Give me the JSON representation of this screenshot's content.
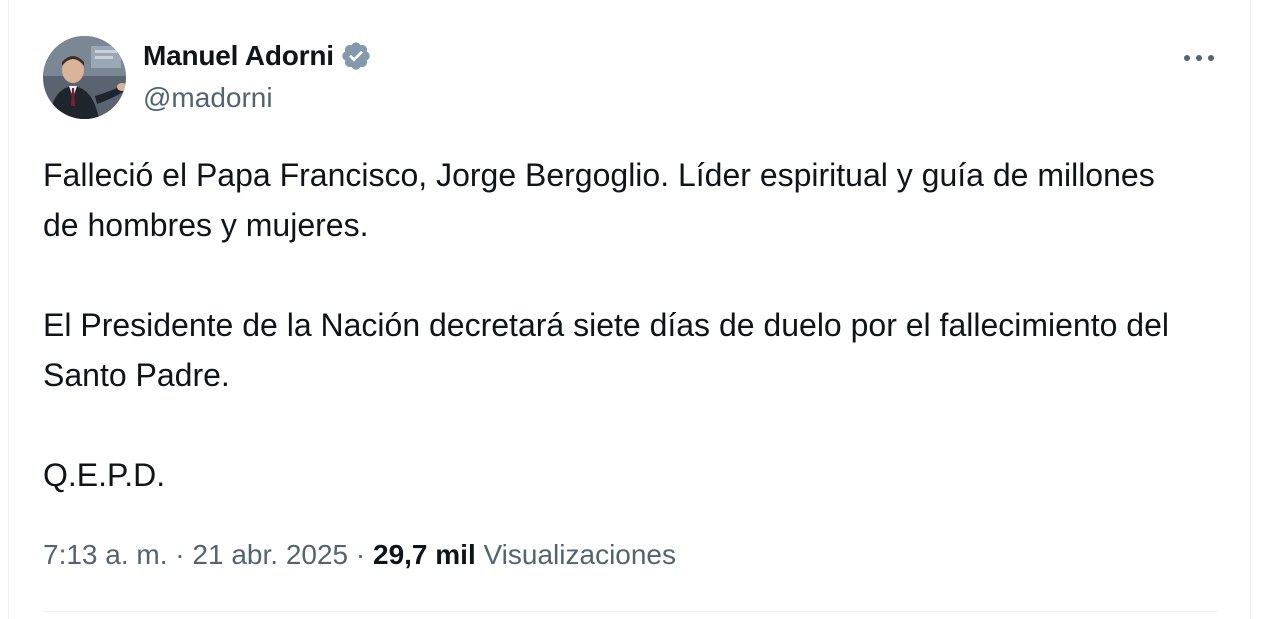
{
  "author": {
    "name": "Manuel Adorni",
    "handle": "@madorni",
    "verified": true
  },
  "tweet": {
    "paragraphs": [
      "Falleció el Papa Francisco, Jorge Bergoglio. Líder espiritual y guía de millones de hombres y mujeres.",
      "El Presidente de la Nación decretará siete días de duelo por el fallecimiento del Santo Padre.",
      "Q.E.P.D."
    ]
  },
  "meta": {
    "time": "7:13 a. m.",
    "separator": "·",
    "date": "21 abr. 2025",
    "views_count": "29,7 mil",
    "views_label": "Visualizaciones"
  },
  "icons": {
    "verified": "verified-badge-icon",
    "more": "more-horizontal-icon"
  },
  "colors": {
    "text_primary": "#0f1419",
    "text_secondary": "#536471",
    "verified_badge": "#829aab",
    "divider": "#eff3f4"
  }
}
